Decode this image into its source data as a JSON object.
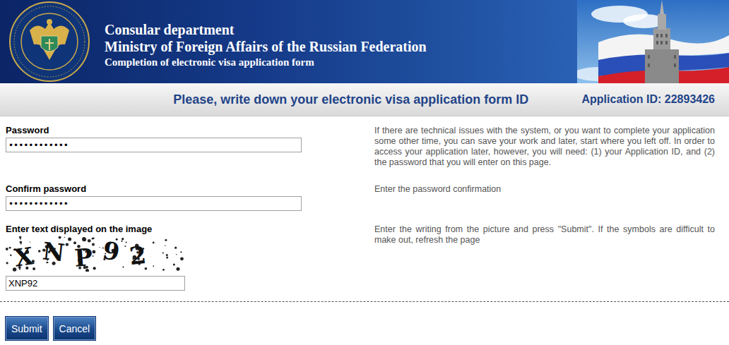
{
  "header": {
    "title": "Consular department",
    "subtitle": "Ministry of Foreign Affairs of the Russian Federation",
    "caption": "Completion of electronic visa application form"
  },
  "banner": {
    "message": "Please, write down your electronic visa application form ID",
    "application_id": "Application ID: 22893426"
  },
  "fields": [
    {
      "kind": "password",
      "label": "Password",
      "value": "••••••••••••",
      "help": "If there are technical issues with the system, or you want to complete your application some other time, you can save your work and later, start where you left off. In order to access your application later, however, you will need: (1) your Application ID, and (2) the password that you will enter on this page."
    },
    {
      "kind": "password",
      "label": "Confirm password",
      "value": "••••••••••••",
      "help": "Enter the password confirmation"
    },
    {
      "kind": "captcha",
      "label": "Enter text displayed on the image",
      "captcha": "XNP92",
      "value": "XNP92",
      "help": "Enter the writing from the picture and press \"Submit\". If the symbols are difficult to make out, refresh the page"
    }
  ],
  "buttons": [
    {
      "label": "Submit"
    },
    {
      "label": "Cancel"
    }
  ]
}
